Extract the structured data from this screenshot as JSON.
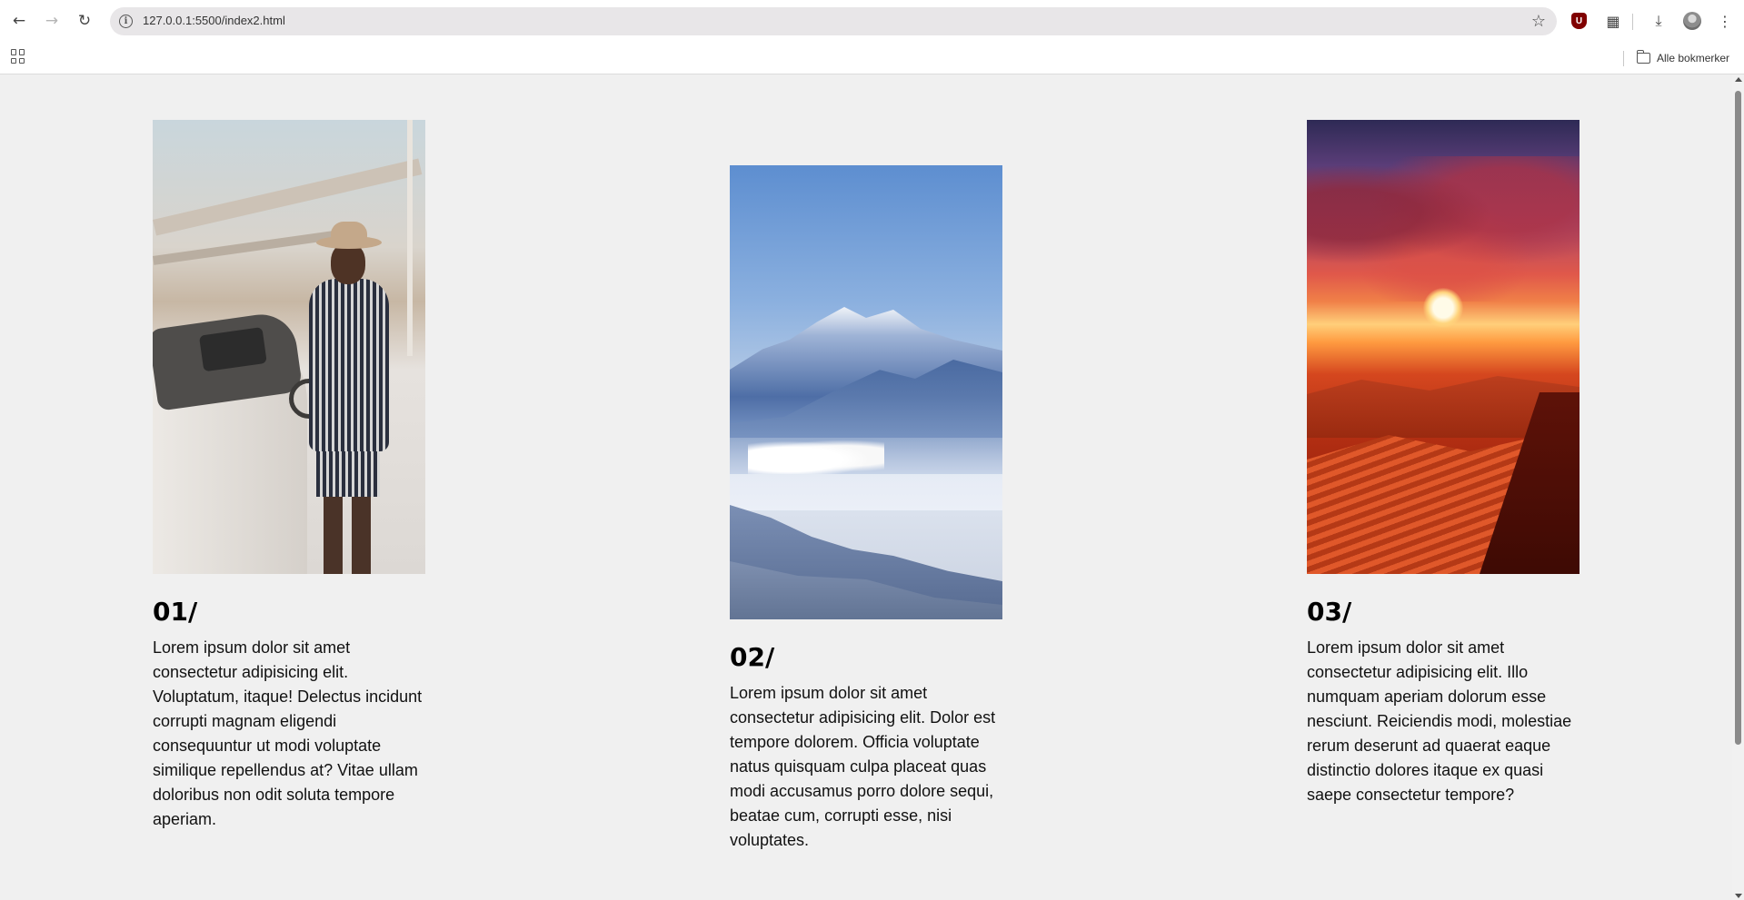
{
  "browser": {
    "url": "127.0.0.1:5500/index2.html",
    "extension_badge": "U",
    "bookmarks_label": "Alle bokmerker",
    "icons": [
      "back-arrow-icon",
      "forward-arrow-icon",
      "reload-icon",
      "site-info-icon",
      "bookmark-star-icon",
      "ublock-icon",
      "extensions-icon",
      "downloads-icon",
      "profile-avatar-icon",
      "menu-kebab-icon",
      "apps-grid-icon",
      "folder-icon"
    ]
  },
  "cards": [
    {
      "number": "01/",
      "text": "Lorem ipsum dolor sit amet consectetur adipisicing elit. Voluptatum, itaque! Delectus incidunt corrupti magnam eligendi consequuntur ut modi voluptate similique repellendus at? Vitae ullam doloribus non odit soluta tempore aperiam."
    },
    {
      "number": "02/",
      "text": "Lorem ipsum dolor sit amet consectetur adipisicing elit. Dolor est tempore dolorem. Officia voluptate natus quisquam culpa placeat quas modi accusamus porro dolore sequi, beatae cum, corrupti esse, nisi voluptates."
    },
    {
      "number": "03/",
      "text": "Lorem ipsum dolor sit amet consectetur adipisicing elit. Illo numquam aperiam dolorum esse nesciunt. Reiciendis modi, molestiae rerum deserunt ad quaerat eaque distinctio dolores itaque ex quasi saepe consectetur tempore?"
    }
  ],
  "colors": {
    "page_background": "#f0f0f0",
    "text": "#111111",
    "ublock_red": "#800000"
  }
}
